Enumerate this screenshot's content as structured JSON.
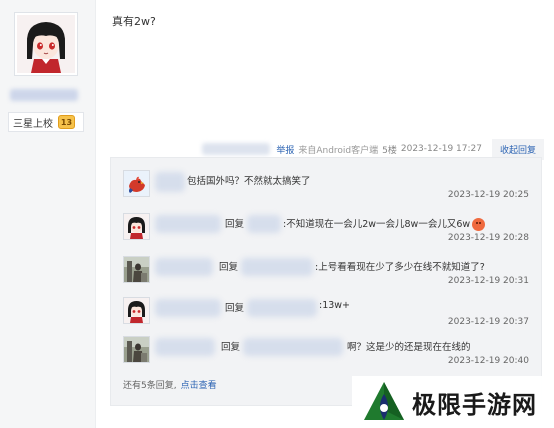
{
  "post": {
    "content": "真有2w?",
    "author_rank": "三星上校",
    "author_level": "13"
  },
  "meta": {
    "report": "举报",
    "source": "来自Android客户端",
    "floor": "5楼",
    "time": "2023-12-19 17:27",
    "collapse": "收起回复"
  },
  "replies": [
    {
      "text": "包括国外吗？不然就太搞笑了",
      "time": "2023-12-19 20:25"
    },
    {
      "prefix": "回复",
      "text": ":不知道现在一会儿2w一会儿8w一会儿又6w",
      "time": "2023-12-19 20:28"
    },
    {
      "prefix": "回复",
      "text": ":上号看看现在少了多少在线不就知道了?",
      "time": "2023-12-19 20:31"
    },
    {
      "prefix": "回复",
      "text": ":13w+",
      "time": "2023-12-19 20:37"
    },
    {
      "prefix": "回复",
      "text": "啊？这是少的还是现在在线的",
      "time": "2023-12-19 20:40"
    }
  ],
  "more": {
    "text": "还有5条回复,",
    "link": "点击查看"
  },
  "watermark": {
    "text": "极限手游网"
  },
  "colors": {
    "link": "#2d64b3",
    "reply_bg": "#f2f3f5",
    "sidebar_bg": "#f5f6f7"
  }
}
